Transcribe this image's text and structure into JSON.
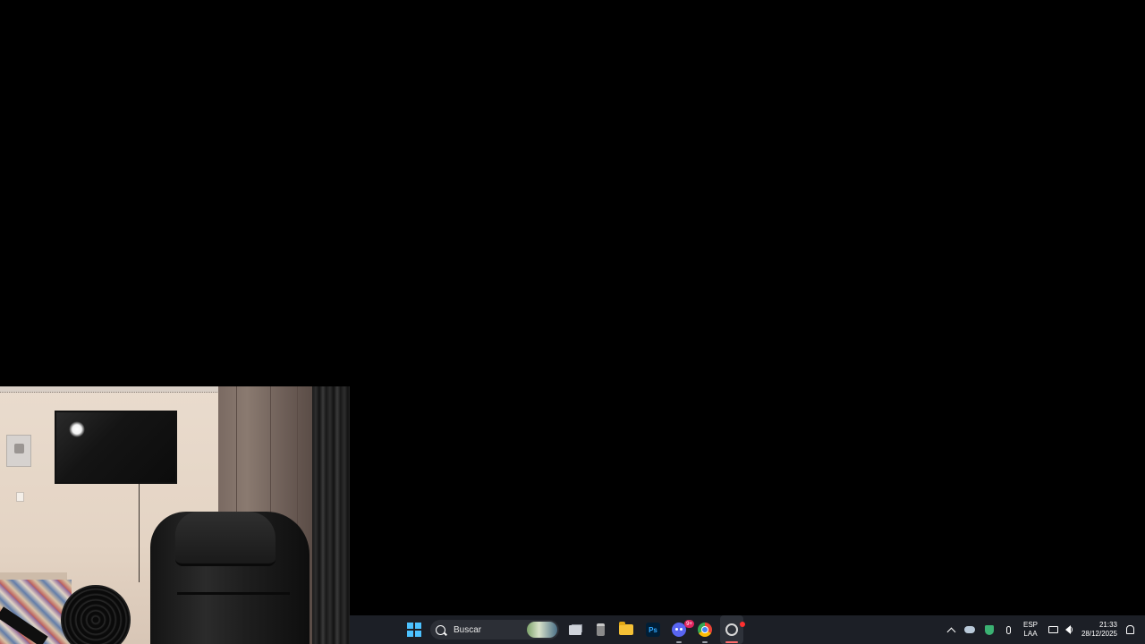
{
  "taskbar": {
    "search_placeholder": "Buscar",
    "discord_badge": "9+",
    "photoshop_label": "Ps",
    "apps": [
      "start",
      "search",
      "task-view",
      "mail",
      "file-explorer",
      "photoshop",
      "discord",
      "chrome",
      "obs"
    ]
  },
  "tray": {
    "lang_line1": "ESP",
    "lang_line2": "LAA",
    "time": "21:33",
    "date": "28/12/2025"
  },
  "colors": {
    "taskbar_bg": "#1c1f26",
    "start_accent": "#4cc2ff",
    "recording": "#ff3030"
  },
  "webcam_preview": {
    "visible": true
  }
}
